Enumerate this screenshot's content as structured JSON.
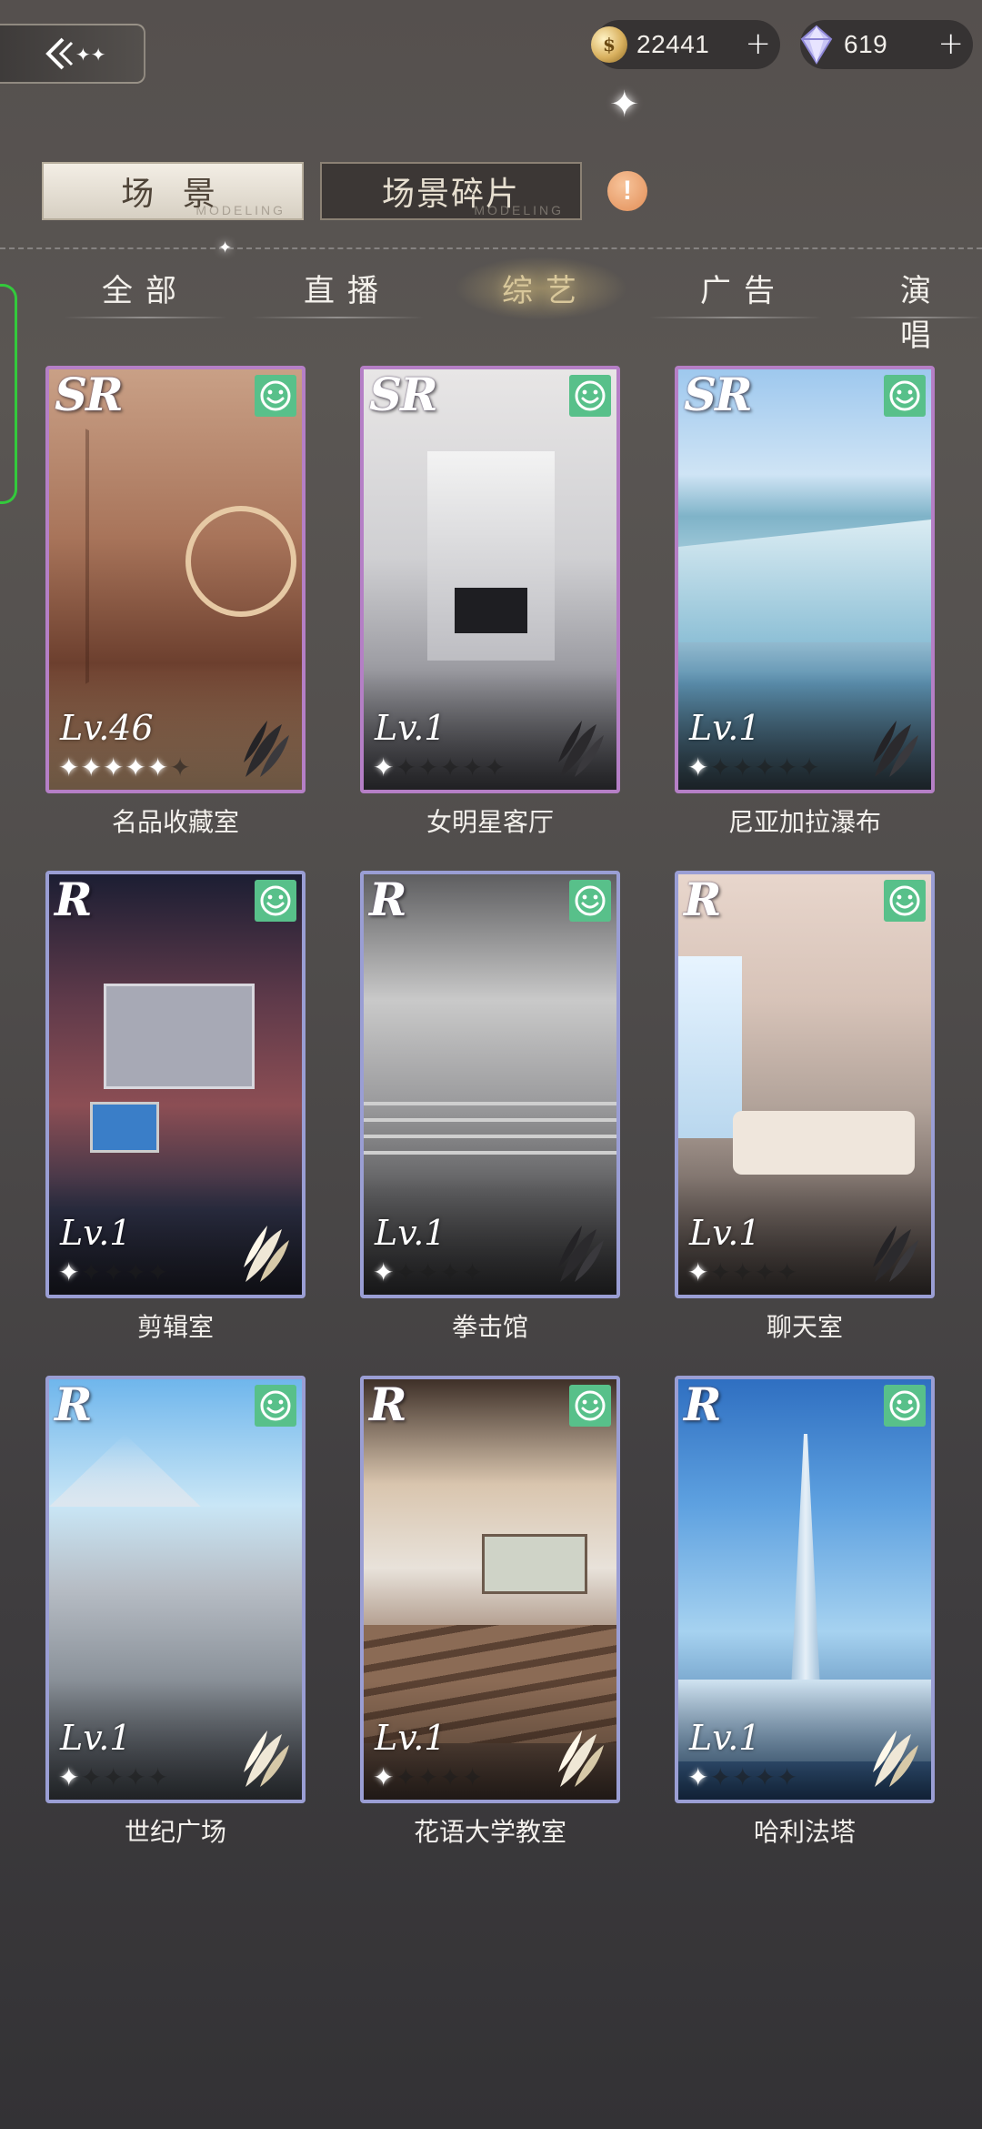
{
  "currencies": [
    {
      "name": "gold-coin",
      "value": "22441",
      "icon": "coin-icon"
    },
    {
      "name": "diamond",
      "value": "619",
      "icon": "gem-icon"
    }
  ],
  "main_tabs": [
    {
      "label": "场 景",
      "sub": "MODELING",
      "active": true
    },
    {
      "label": "场景碎片",
      "sub": "MODELING",
      "active": false
    }
  ],
  "categories": [
    {
      "label": "全部",
      "active": false
    },
    {
      "label": "直播",
      "active": false
    },
    {
      "label": "综艺",
      "active": true
    },
    {
      "label": "广告",
      "active": false
    },
    {
      "label": "演唱",
      "active": false
    }
  ],
  "cards": [
    {
      "name": "名品收藏室",
      "rarity": "SR",
      "level": "Lv.46",
      "stars_filled": 5,
      "stars_total": 6
    },
    {
      "name": "女明星客厅",
      "rarity": "SR",
      "level": "Lv.1",
      "stars_filled": 1,
      "stars_total": 6
    },
    {
      "name": "尼亚加拉瀑布",
      "rarity": "SR",
      "level": "Lv.1",
      "stars_filled": 1,
      "stars_total": 6
    },
    {
      "name": "剪辑室",
      "rarity": "R",
      "level": "Lv.1",
      "stars_filled": 1,
      "stars_total": 5
    },
    {
      "name": "拳击馆",
      "rarity": "R",
      "level": "Lv.1",
      "stars_filled": 1,
      "stars_total": 5
    },
    {
      "name": "聊天室",
      "rarity": "R",
      "level": "Lv.1",
      "stars_filled": 1,
      "stars_total": 5
    },
    {
      "name": "世纪广场",
      "rarity": "R",
      "level": "Lv.1",
      "stars_filled": 1,
      "stars_total": 5
    },
    {
      "name": "花语大学教室",
      "rarity": "R",
      "level": "Lv.1",
      "stars_filled": 1,
      "stars_total": 5
    },
    {
      "name": "哈利法塔",
      "rarity": "R",
      "level": "Lv.1",
      "stars_filled": 1,
      "stars_total": 5
    }
  ],
  "colors": {
    "sr_border": "#b57fc6",
    "r_border": "#9a9ed4",
    "smile_badge": "#58c08a",
    "alert": "#e9955f"
  }
}
